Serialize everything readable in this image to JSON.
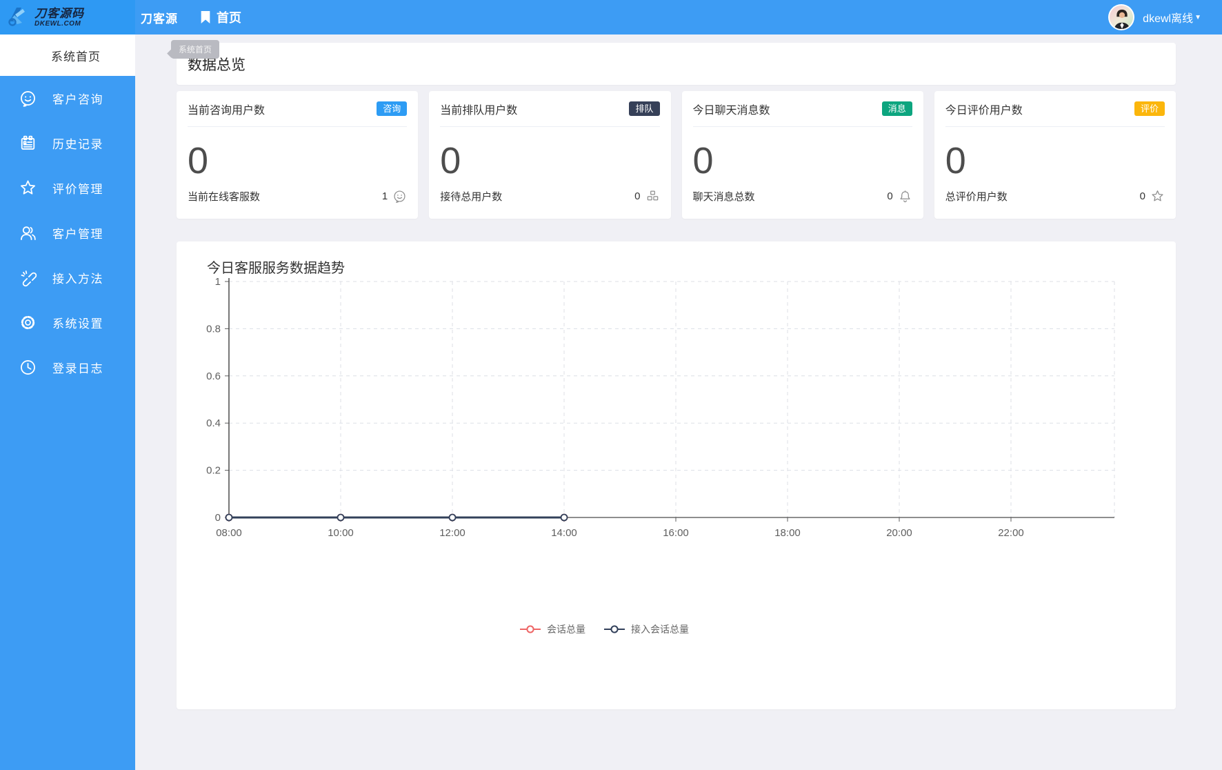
{
  "topbar": {
    "logo": {
      "brand_cn": "刀客源码",
      "brand_domain": "DKEWL.COM",
      "brand_side": "刀客源"
    },
    "tab": {
      "label": "首页",
      "icon": "bookmark"
    },
    "user": {
      "name_status": "dkewl离线",
      "caret": "▼",
      "avatar_icon": "agent-avatar"
    }
  },
  "tab_tooltip": {
    "text": "系统首页"
  },
  "sidebar": {
    "active_item": {
      "label": "系统首页"
    },
    "items": [
      {
        "key": "customer-consult",
        "icon": "smiley",
        "label": "客户咨询"
      },
      {
        "key": "history-records",
        "icon": "history",
        "label": "历史记录"
      },
      {
        "key": "review-management",
        "icon": "star",
        "label": "评价管理"
      },
      {
        "key": "customer-management",
        "icon": "users",
        "label": "客户管理"
      },
      {
        "key": "access-methods",
        "icon": "connect",
        "label": "接入方法"
      },
      {
        "key": "system-settings",
        "icon": "gear",
        "label": "系统设置"
      },
      {
        "key": "login-logs",
        "icon": "clock",
        "label": "登录日志"
      }
    ]
  },
  "overview": {
    "title": "数据总览",
    "cards": [
      {
        "title": "当前咨询用户数",
        "badge": "咨询",
        "badge_color": "#2D9CF4",
        "value": "0",
        "sub_label": "当前在线客服数",
        "sub_value": "1",
        "sub_icon": "smiley"
      },
      {
        "title": "当前排队用户数",
        "badge": "排队",
        "badge_color": "#364058",
        "value": "0",
        "sub_label": "接待总用户数",
        "sub_value": "0",
        "sub_icon": "users-grid"
      },
      {
        "title": "今日聊天消息数",
        "badge": "消息",
        "badge_color": "#0DA57F",
        "value": "0",
        "sub_label": "聊天消息总数",
        "sub_value": "0",
        "sub_icon": "bell"
      },
      {
        "title": "今日评价用户数",
        "badge": "评价",
        "badge_color": "#FBB60C",
        "value": "0",
        "sub_label": "总评价用户数",
        "sub_value": "0",
        "sub_icon": "star"
      }
    ]
  },
  "chart_card": {
    "title": "今日客服服务数据趋势"
  },
  "chart_data": {
    "type": "line",
    "title": "今日客服服务数据趋势",
    "x": [
      "08:00",
      "10:00",
      "12:00",
      "14:00",
      "16:00",
      "18:00",
      "20:00",
      "22:00"
    ],
    "series": [
      {
        "name": "会话总量",
        "color": "#EE6666",
        "values": [
          0,
          0,
          0,
          0
        ]
      },
      {
        "name": "接入会话总量",
        "color": "#32405A",
        "values": [
          0,
          0,
          0,
          0
        ]
      }
    ],
    "xlabel": "",
    "ylabel": "",
    "ylim": [
      0,
      1
    ],
    "yticks": [
      0,
      0.2,
      0.4,
      0.6,
      0.8,
      1
    ],
    "grid": true,
    "grid_style": "dashed",
    "legend_position": "bottom"
  }
}
